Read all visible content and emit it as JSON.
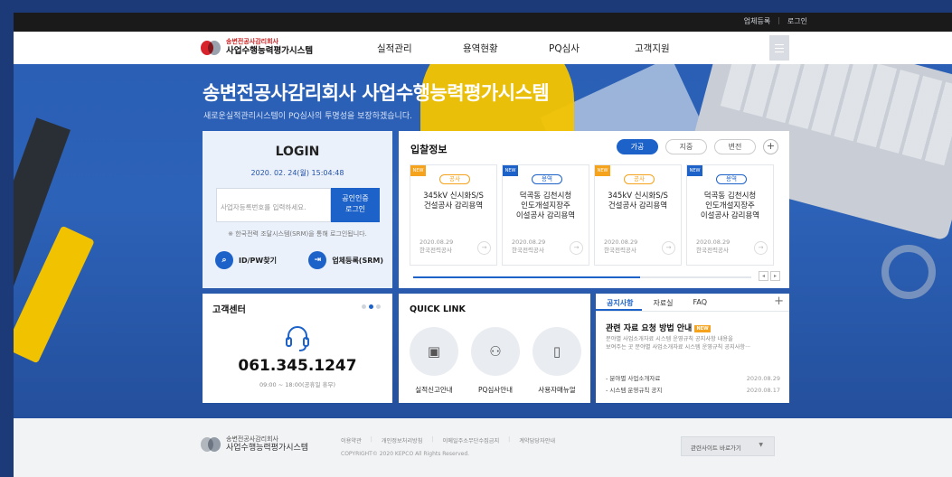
{
  "header": {
    "util_links": [
      "업체등록",
      "로그인"
    ],
    "logo_line1": "송변전공사감리회사",
    "logo_line2": "사업수행능력평가시스템",
    "menu": [
      "실적관리",
      "용역현황",
      "PQ심사",
      "고객지원"
    ],
    "menu_icon": "hamburger-menu-icon"
  },
  "hero": {
    "title": "송변전공사감리회사 사업수행능력평가시스템",
    "subtitle": "새로운실적관리시스템이 PQ심사의 투명성을 보장하겠습니다."
  },
  "login": {
    "title": "LOGIN",
    "datetime": "2020. 02. 24(월) 15:04:48",
    "id_placeholder": "사업자등록번호를 입력하세요.",
    "cert_button_line1": "공인인증",
    "cert_button_line2": "로그인",
    "note": "※ 한국전력 조달시스템(SRM)을 통해 로그인됩니다.",
    "find_link": "ID/PW찾기",
    "register_link": "업체등록(SRM)"
  },
  "bids": {
    "title": "입찰정보",
    "tabs": [
      "가공",
      "지중",
      "변전"
    ],
    "active_tab": "가공",
    "items": [
      {
        "tag": "NEW",
        "tag_color": "#f5a21c",
        "badge": "공사",
        "badge_color": "#f5a21c",
        "line1": "345kV 신시화S/S",
        "line2": "건설공사 감리용역",
        "line3": "",
        "date": "2020.08.29",
        "org": "한국전력공사"
      },
      {
        "tag": "NEW",
        "tag_color": "#1d62c9",
        "badge": "용역",
        "badge_color": "#1d62c9",
        "line1": "덕곡동 김천시청",
        "line2": "인도개설지장주",
        "line3": "이설공사 감리용역",
        "date": "2020.08.29",
        "org": "한국전력공사"
      },
      {
        "tag": "NEW",
        "tag_color": "#f5a21c",
        "badge": "공사",
        "badge_color": "#f5a21c",
        "line1": "345kV 신시화S/S",
        "line2": "건설공사 감리용역",
        "line3": "",
        "date": "2020.08.29",
        "org": "한국전력공사"
      },
      {
        "tag": "NEW",
        "tag_color": "#1d62c9",
        "badge": "용역",
        "badge_color": "#1d62c9",
        "line1": "덕곡동 김천시청",
        "line2": "인도개설지장주",
        "line3": "이설공사 감리용역",
        "date": "2020.08.29",
        "org": "한국전력공사"
      }
    ],
    "progress": 0.67
  },
  "customer_center": {
    "title": "고객센터",
    "phone": "061.345.1247",
    "hours": "09:00 ~ 18:00(공휴일 휴무)"
  },
  "quick_link": {
    "title": "QUICK LINK",
    "items": [
      {
        "label": "실적신고안내",
        "icon": "safe-icon"
      },
      {
        "label": "PQ심사안내",
        "icon": "people-icon"
      },
      {
        "label": "사용자매뉴얼",
        "icon": "book-icon"
      }
    ]
  },
  "notice": {
    "tabs": [
      "공지사항",
      "자료실",
      "FAQ"
    ],
    "active_tab": "공지사항",
    "headline": "관련 자료 요청 방법 안내",
    "headline_badge": "NEW",
    "desc_line1": "분야별 사업소개자료 시스템 운영규칙 공지사항 내용을",
    "desc_line2": "보여주는 곳 분야별 사업소개자료 시스템 운영규칙 공지사항···",
    "list": [
      {
        "text": "- 분야별 사업소개자료",
        "date": "2020.08.29"
      },
      {
        "text": "- 시스템 운영규칙 공지",
        "date": "2020.08.17"
      }
    ]
  },
  "footer": {
    "logo_line1": "송변전공사감리회사",
    "logo_line2": "사업수행능력평가시스템",
    "links": [
      "이용약관",
      "개인정보처리방침",
      "이메일주소무단수집금지",
      "계약담당자안내"
    ],
    "copyright": "COPYRIGHT© 2020 KEPCO All Rights Reserved.",
    "family_site": "관련사이트 바로가기"
  }
}
